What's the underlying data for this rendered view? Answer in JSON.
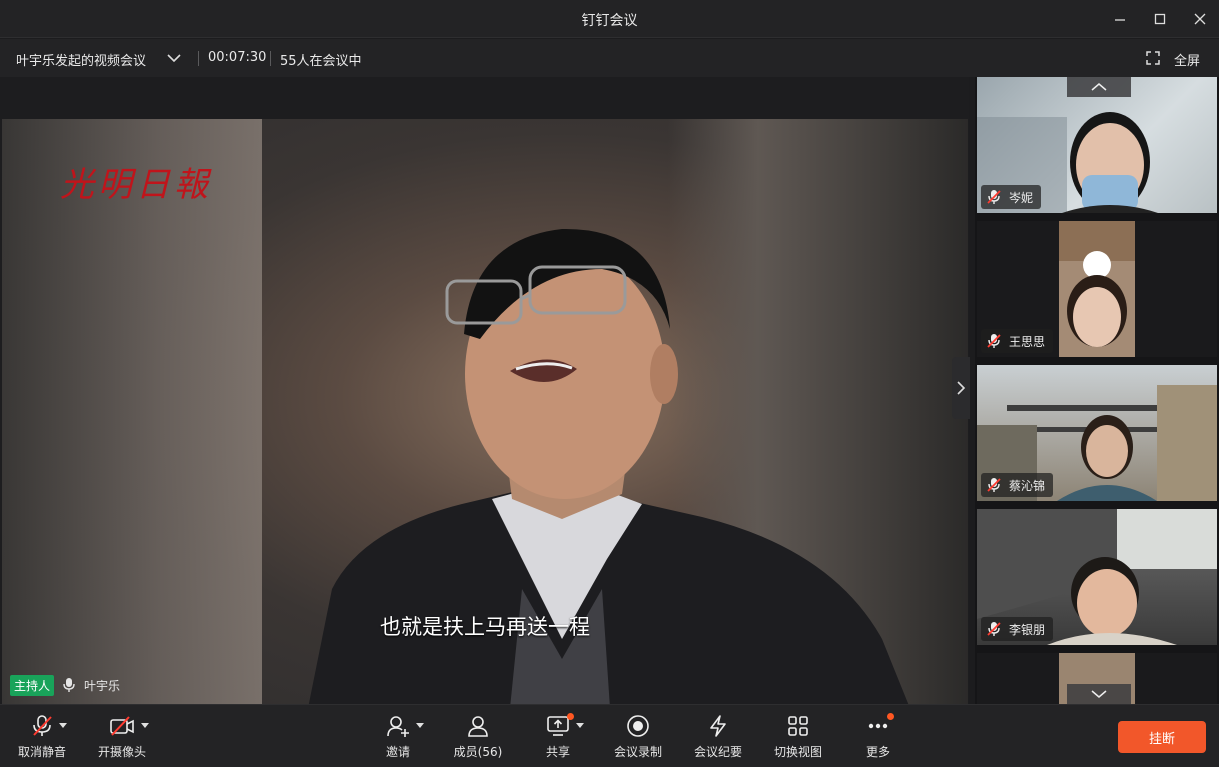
{
  "window": {
    "title": "钉钉会议"
  },
  "info": {
    "meeting_name": "叶宇乐发起的视频会议",
    "elapsed": "00:07:30",
    "participants_in_meeting": "55人在会议中",
    "fullscreen_label": "全屏"
  },
  "main_video": {
    "logo_text": "光明日報",
    "subtitle": "也就是扶上马再送一程",
    "host_badge": "主持人",
    "host_name": "叶宇乐"
  },
  "participants": [
    {
      "name": "岑妮",
      "muted": true
    },
    {
      "name": "王思思",
      "muted": true
    },
    {
      "name": "蔡沁锦",
      "muted": true
    },
    {
      "name": "李银朋",
      "muted": true
    }
  ],
  "toolbar": {
    "unmute": "取消静音",
    "camera": "开摄像头",
    "invite": "邀请",
    "members": "成员(56)",
    "share": "共享",
    "record": "会议录制",
    "minutes": "会议纪要",
    "switch_view": "切换视图",
    "more": "更多",
    "hangup": "挂断"
  },
  "colors": {
    "accent_green": "#19a35a",
    "hangup_orange": "#f2572a",
    "notify_dot": "#ff5722"
  }
}
